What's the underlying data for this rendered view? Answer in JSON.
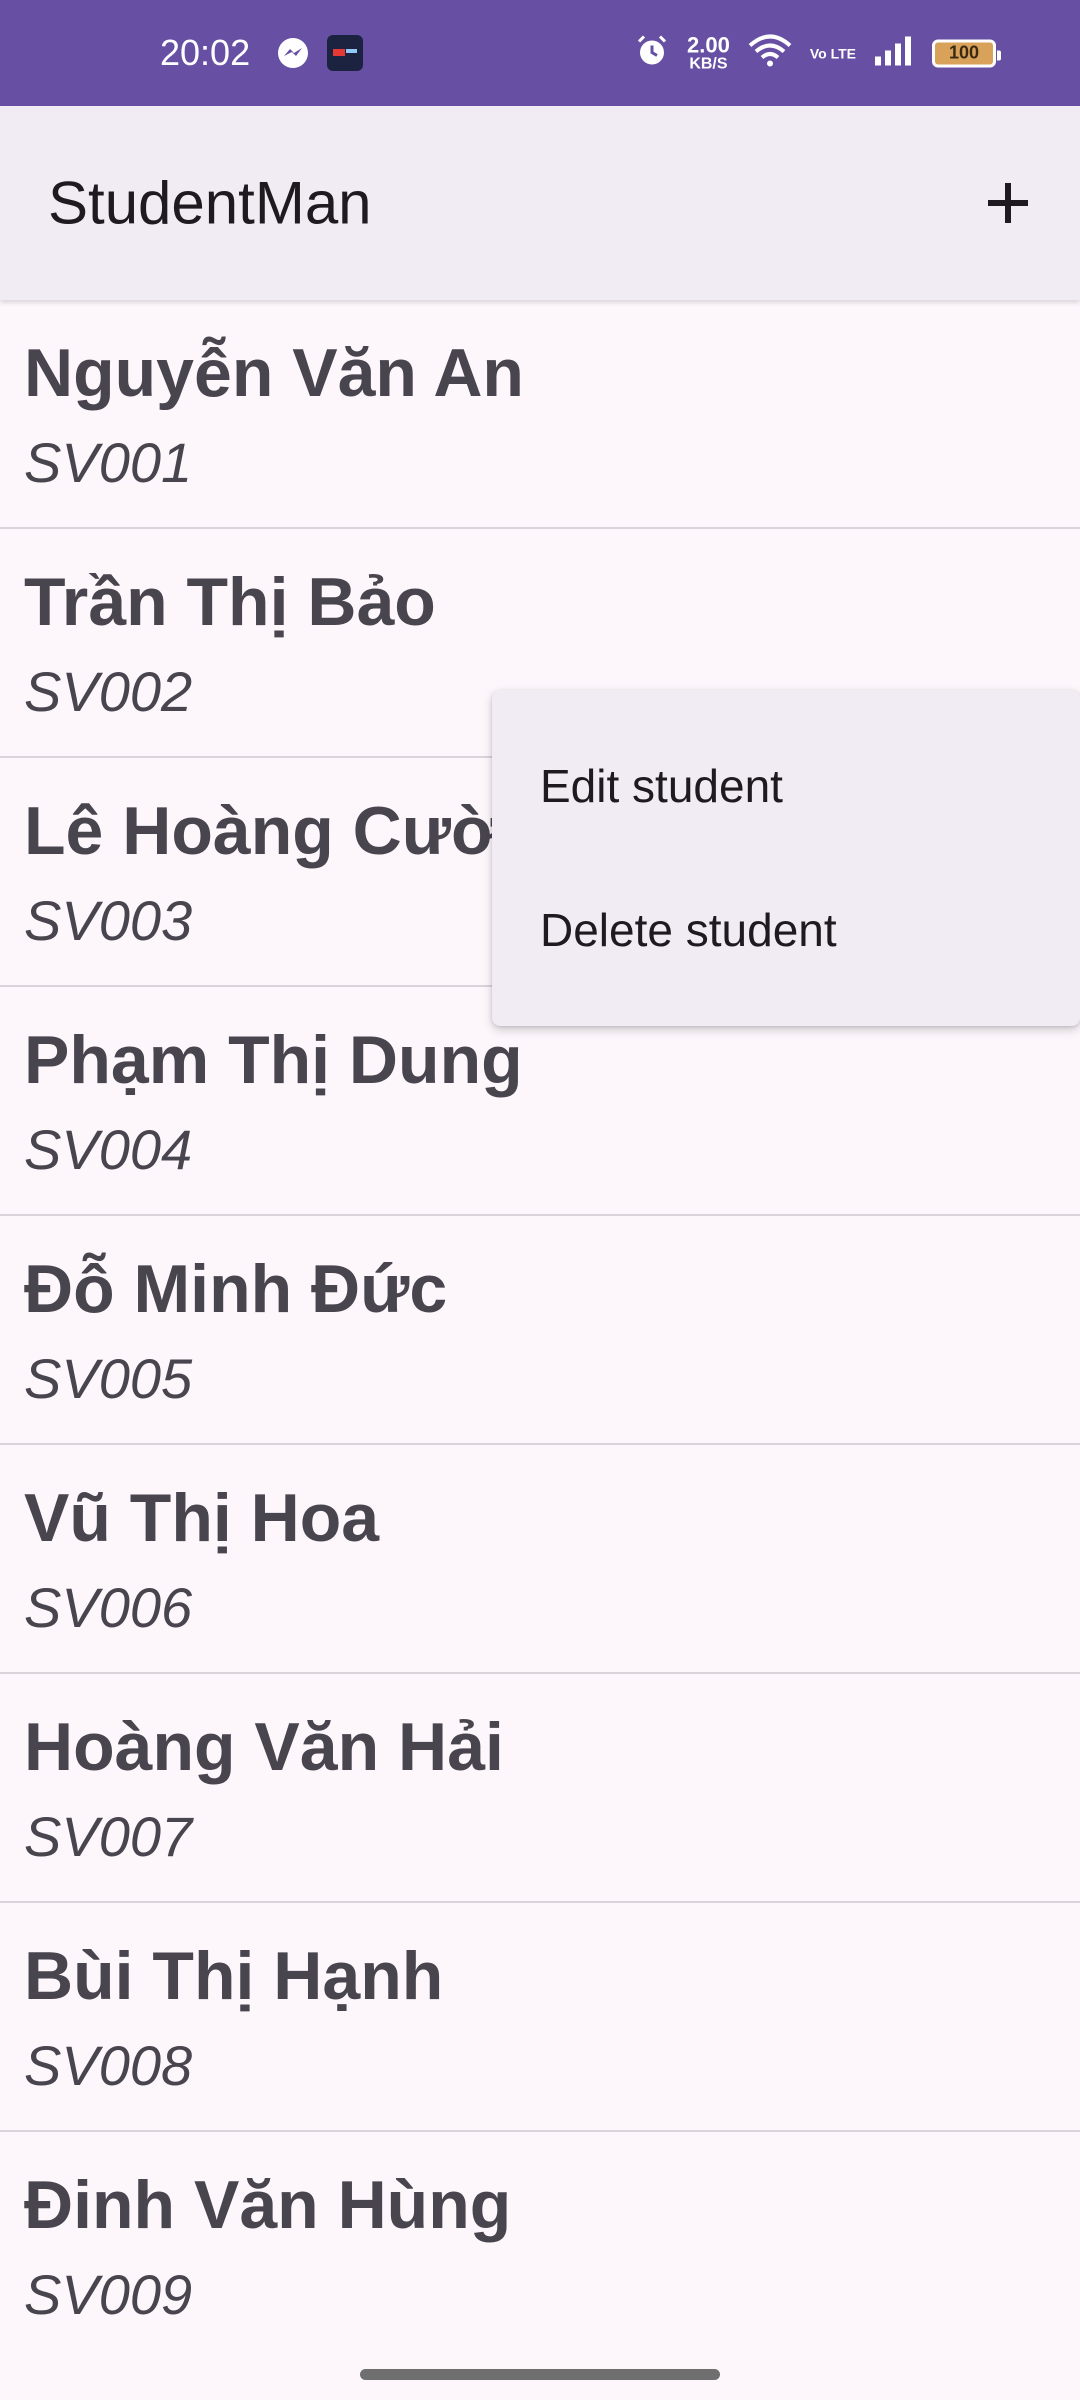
{
  "status_bar": {
    "time": "20:02",
    "speed_value": "2.00",
    "speed_unit": "KB/S",
    "network_badge": "Vo LTE",
    "battery": "100",
    "background_color": "#6750A4"
  },
  "app_bar": {
    "title": "StudentMan",
    "add_icon": "plus-icon"
  },
  "students": [
    {
      "name": "Nguyễn Văn An",
      "id": "SV001"
    },
    {
      "name": "Trần Thị Bảo",
      "id": "SV002"
    },
    {
      "name": "Lê Hoàng Cườn",
      "id": "SV003"
    },
    {
      "name": "Phạm Thị Dung",
      "id": "SV004"
    },
    {
      "name": "Đỗ Minh Đức",
      "id": "SV005"
    },
    {
      "name": "Vũ Thị Hoa",
      "id": "SV006"
    },
    {
      "name": "Hoàng Văn Hải",
      "id": "SV007"
    },
    {
      "name": "Bùi Thị Hạnh",
      "id": "SV008"
    },
    {
      "name": "Đinh Văn Hùng",
      "id": "SV009"
    }
  ],
  "context_menu": {
    "items": [
      {
        "label": "Edit student"
      },
      {
        "label": "Delete student"
      }
    ]
  }
}
